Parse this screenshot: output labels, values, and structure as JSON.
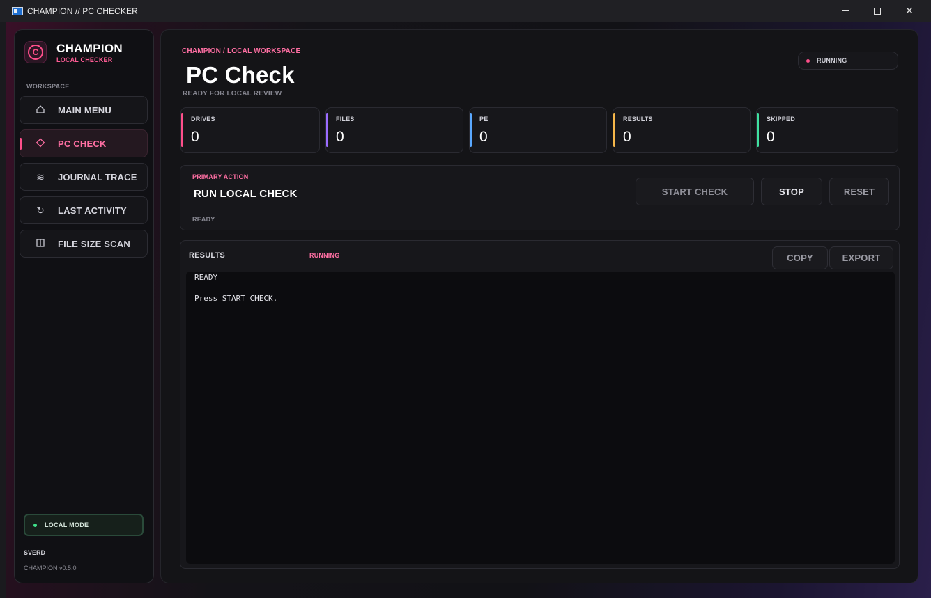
{
  "window": {
    "title": "CHAMPION // PC CHECKER"
  },
  "sidebar": {
    "brand_title": "CHAMPION",
    "brand_subtitle": "LOCAL CHECKER",
    "logo_letter": "C",
    "section_label": "WORKSPACE",
    "items": [
      {
        "label": "MAIN MENU",
        "icon": "home-icon",
        "active": false
      },
      {
        "label": "PC CHECK",
        "icon": "diamond-icon",
        "active": true
      },
      {
        "label": "JOURNAL TRACE",
        "icon": "wave-icon",
        "active": false
      },
      {
        "label": "LAST ACTIVITY",
        "icon": "refresh-icon",
        "active": false
      },
      {
        "label": "FILE SIZE SCAN",
        "icon": "columns-icon",
        "active": false
      }
    ],
    "mode_label": "LOCAL MODE",
    "user": "SVERD",
    "version": "CHAMPION v0.5.0"
  },
  "header": {
    "breadcrumb": "CHAMPION / LOCAL WORKSPACE",
    "title": "PC Check",
    "subtitle": "READY FOR LOCAL REVIEW",
    "status": "RUNNING"
  },
  "stats": [
    {
      "label": "DRIVES",
      "value": "0",
      "color": "#ff4f8b"
    },
    {
      "label": "FILES",
      "value": "0",
      "color": "#9b6cff"
    },
    {
      "label": "PE",
      "value": "0",
      "color": "#5aa8ff"
    },
    {
      "label": "RESULTS",
      "value": "0",
      "color": "#f5b64a"
    },
    {
      "label": "SKIPPED",
      "value": "0",
      "color": "#3fe0a0"
    }
  ],
  "action": {
    "kicker": "PRIMARY ACTION",
    "title": "RUN LOCAL CHECK",
    "status": "READY",
    "start_label": "START CHECK",
    "stop_label": "STOP",
    "reset_label": "RESET"
  },
  "results": {
    "title": "RESULTS",
    "status": "RUNNING",
    "copy_label": "COPY",
    "export_label": "EXPORT",
    "lines": [
      "READY",
      "Press START CHECK."
    ]
  },
  "colors": {
    "accent": "#ff4f8b",
    "success": "#3fe08a"
  }
}
